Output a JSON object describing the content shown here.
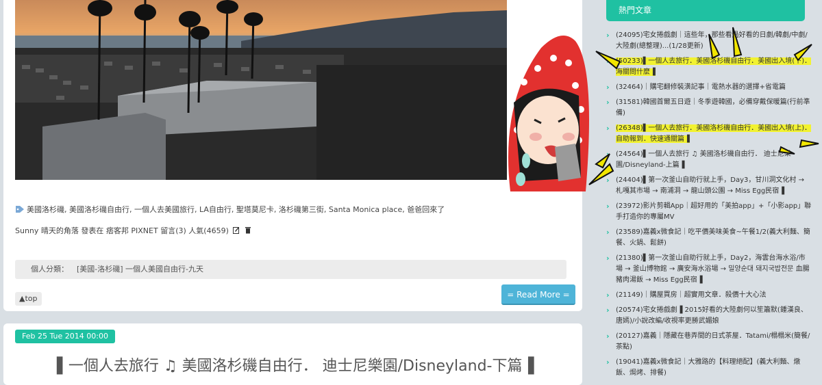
{
  "post": {
    "photo_alt": "santa-monica-pier-sunset-photo",
    "tags": "美國洛杉磯, 美國洛杉磯自由行, 一個人去美國旅行, LA自由行, 聖塔莫尼卡, 洛杉磯第三街, Santa Monica place, 爸爸回來了",
    "byline": "Sunny 晴天的角落 發表在 痞客邦 PIXNET 留言(3) 人氣(4659)",
    "category_label": "個人分類：",
    "category_value": "[美國-洛杉磯] 一個人美國自由行-九天",
    "top_label": "▲top",
    "read_more_label": "= Read More ="
  },
  "next_post": {
    "date": "Feb 25 Tue 2014 00:00",
    "title": "▌一個人去旅行 ♫ 美國洛杉磯自由行． 迪士尼樂園/Disneyland-下篇▐"
  },
  "sidebar": {
    "hot_title": "熱門文章",
    "items": [
      {
        "text": "(24095)宅女捲戲劇｜這些年，那些看過好看的日劇/韓劇/中劇/大陸劇(總整理)...(1/28更新)",
        "highlight": false
      },
      {
        "text": "(50233)▌一個人去旅行．美國洛杉磯自由行．美國出入境(下)．海關問什麼▐",
        "highlight": true
      },
      {
        "text": "(32464)｜購宅翻修裝潢記事｜電熱水器的選擇+省電篇",
        "highlight": false
      },
      {
        "text": "(31581)韓國首爾五日遊｜冬季遊韓國，必備穿戴保暖篇(行前準備)",
        "highlight": false
      },
      {
        "text": "(26348)▌一個人去旅行．美國洛杉磯自由行．美國出入境(上)．自助報到．快速通關篇▐",
        "highlight": true
      },
      {
        "text": "(24564)▌一個人去旅行 ♫ 美國洛杉磯自由行． 迪士尼樂園/Disneyland-上篇▐",
        "highlight": false
      },
      {
        "text": "(24404)▌第一次釜山自助行就上手，Day3，甘川洞文化村 → 札嘎其市場 → 南浦洞 → 龍山頭公園 → Miss Egg民宿▐",
        "highlight": false
      },
      {
        "text": "(23972)影片剪輯App｜超好用的「美拍app」+「小影app」聯手打造你的專屬MV",
        "highlight": false
      },
      {
        "text": "(23589)嘉義x微食記｜吃平價美味美食~午餐1/2(義大利麵、簡餐、火鍋、鬆餅)",
        "highlight": false
      },
      {
        "text": "(21380)▌第一次釜山自助行就上手，Day2，海雲台海水浴/市場 → 釜山博物館 → 廣安海水浴場 → 밀양순대 돼지국밥전문 血腸豬肉湯飯 → Miss Egg民宿▐",
        "highlight": false
      },
      {
        "text": "(21149)｜購屋買房｜超實用文章．殺價十大心法",
        "highlight": false
      },
      {
        "text": "(20574)宅女捲戲劇▐ 2015好看的大陸劇何以笙簫默(鍾漢良、唐嫣)/小說改編/收視率更勝武媚娘",
        "highlight": false
      },
      {
        "text": "(20127)嘉義｜隱藏在巷弄間的日式茶屋．Tatami/榻榻米(簡餐/茶點)",
        "highlight": false
      },
      {
        "text": "(19041)嘉義x微食記｜大雅路的【料理絕配】(義大利麵、燉飯、焗烤、排餐)",
        "highlight": false
      }
    ]
  },
  "colors": {
    "accent_teal": "#1fc1a2",
    "read_more_blue": "#4eb4d8",
    "highlight_yellow": "#f2f230",
    "page_bg": "#d9dfe4"
  }
}
